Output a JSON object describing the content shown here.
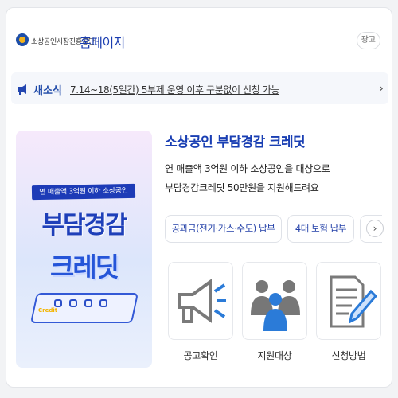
{
  "header": {
    "org_name": "소상공인시장진흥공단",
    "link_label": "홈페이지",
    "ad_label": "광고"
  },
  "notice": {
    "label": "새소식",
    "text": "7.14~18(5일간) 5부제 운영 이후 구분없이 신청 가능"
  },
  "promo_image": {
    "subtitle": "연 매출액 3억원 이하 소상공인",
    "title_line1": "부담경감",
    "title_line2": "크레딧",
    "card_text": "Credit"
  },
  "main": {
    "title": "소상공인 부담경감 크레딧",
    "desc_line1": "연 매출액 3억원 이하 소상공인을 대상으로",
    "desc_line2": "부담경감크레딧 50만원을 지원해드려요"
  },
  "chips": [
    {
      "label": "공과금(전기·가스·수도) 납부"
    },
    {
      "label": "4대 보험 납부"
    }
  ],
  "tiles": [
    {
      "label": "공고확인",
      "icon": "megaphone-icon"
    },
    {
      "label": "지원대상",
      "icon": "people-icon"
    },
    {
      "label": "신청방법",
      "icon": "document-pen-icon"
    }
  ],
  "colors": {
    "brand_blue": "#1a3fb3",
    "accent_blue": "#2b7bd8",
    "icon_gray": "#7a7a7a"
  }
}
